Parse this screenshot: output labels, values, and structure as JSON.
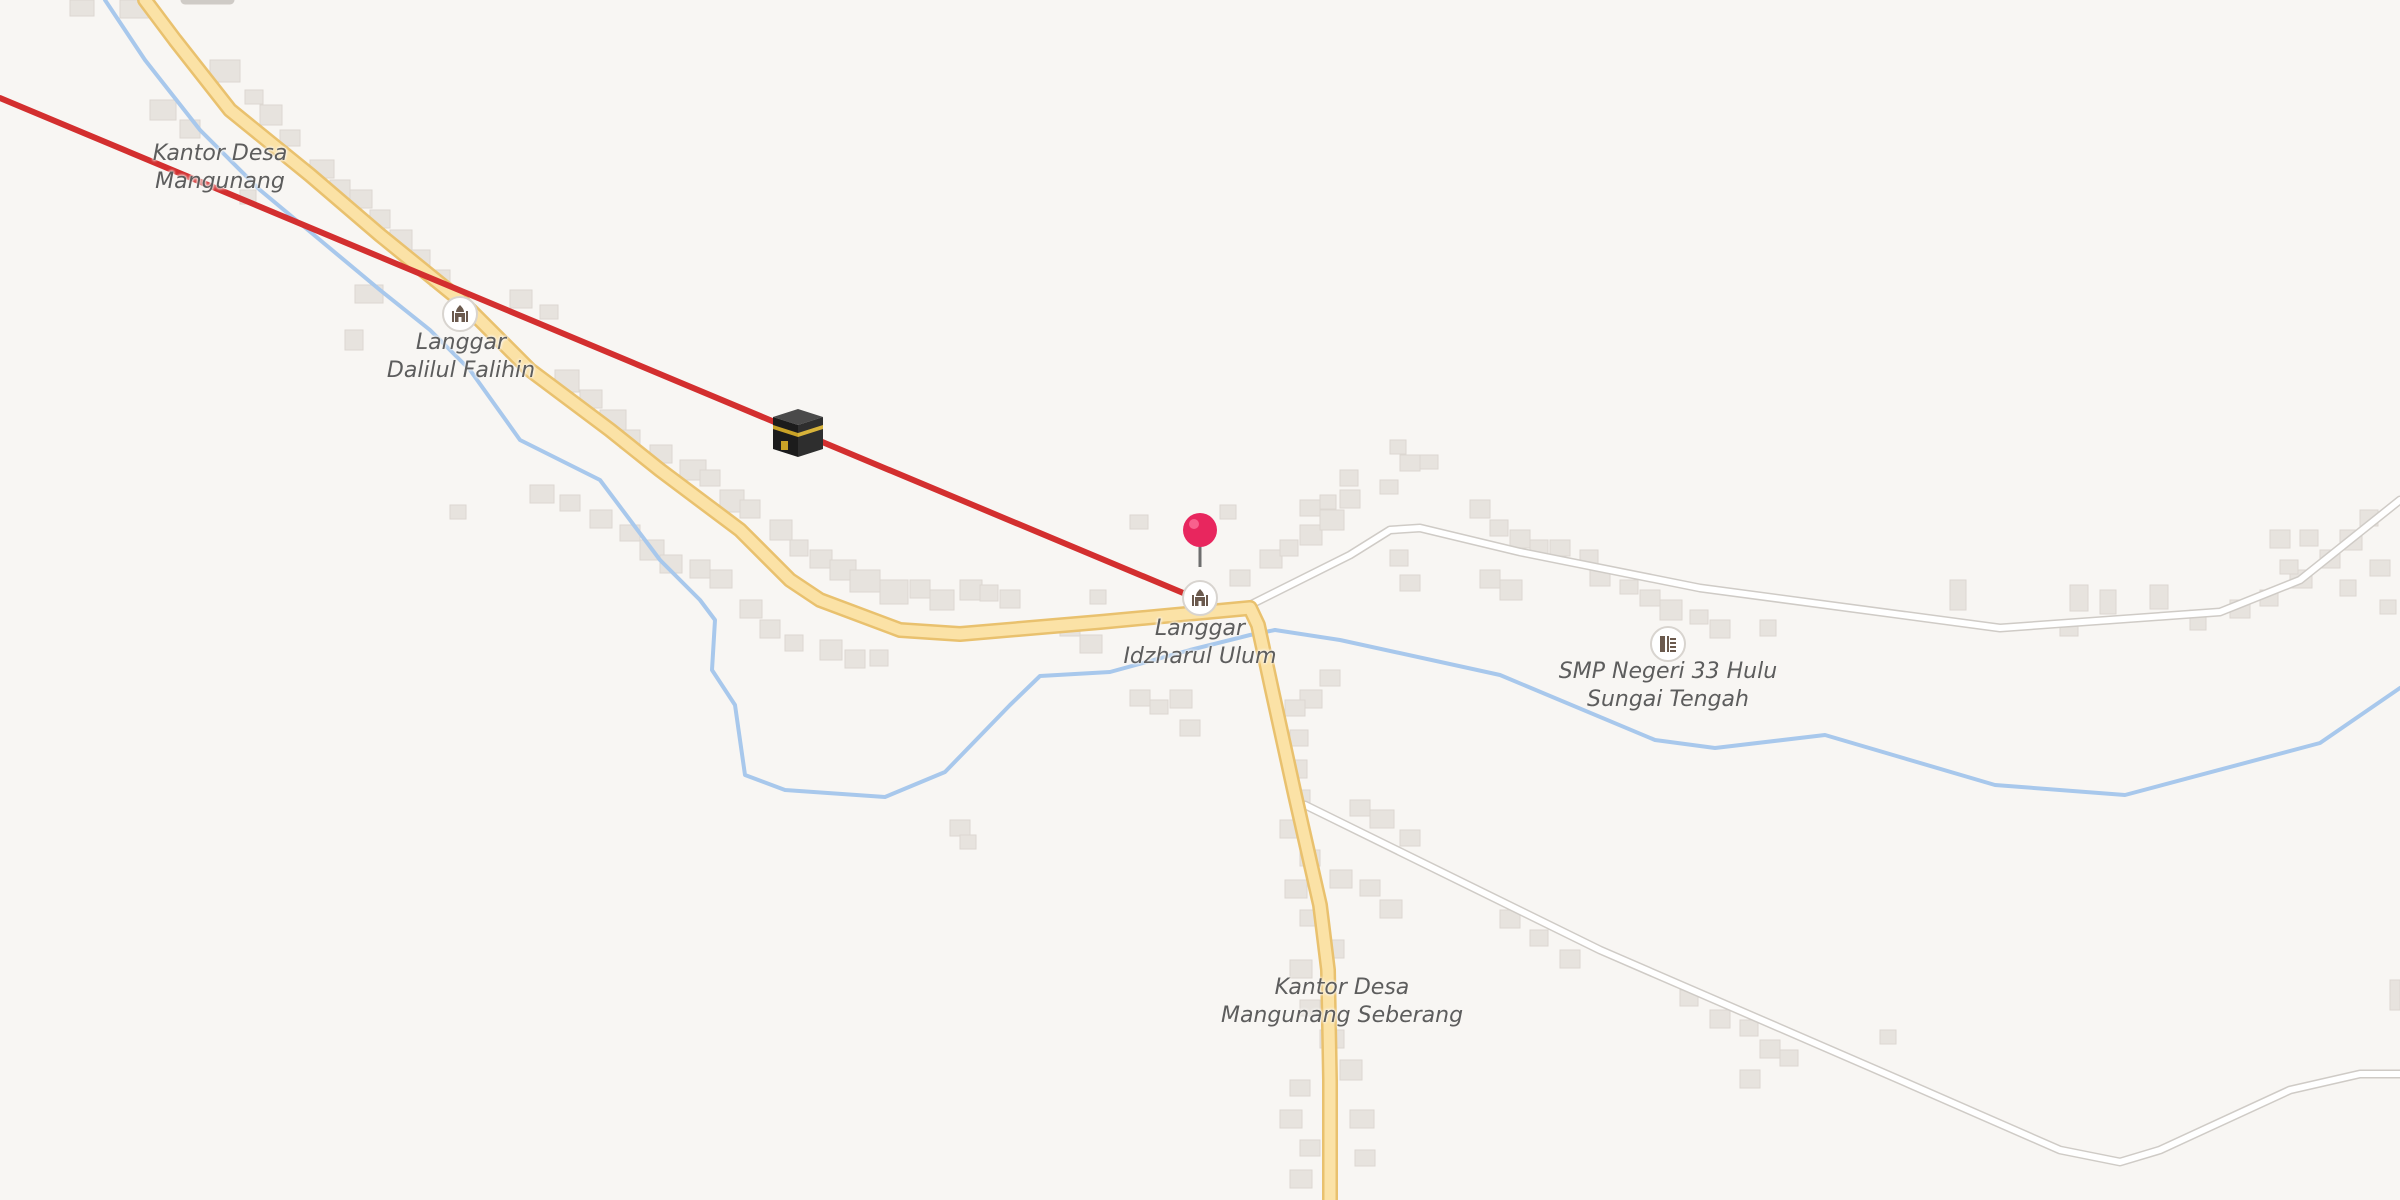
{
  "map": {
    "colors": {
      "background": "#f8f6f3",
      "building": "#e7e3de",
      "road_major": "#fbe2a6",
      "road_major_casing": "#e9c16e",
      "road_minor": "#ffffff",
      "road_minor_casing": "#cfcbc6",
      "river": "#a8c8ec",
      "qibla_line": "#d32f2f",
      "pin": "#e8265e"
    },
    "labels": [
      {
        "id": "kantor-desa-mangunang",
        "lines": [
          "Kantor Desa",
          "Mangunang"
        ]
      },
      {
        "id": "langgar-dalilul-falihin",
        "lines": [
          "Langgar",
          "Dalilul Falihin"
        ]
      },
      {
        "id": "langgar-idzharul-ulum",
        "lines": [
          "Langgar",
          "Idzharul Ulum"
        ]
      },
      {
        "id": "smp-negeri-33",
        "lines": [
          "SMP Negeri 33 Hulu",
          "Sungai Tengah"
        ]
      },
      {
        "id": "kantor-desa-mangunang-seberang",
        "lines": [
          "Kantor Desa",
          "Mangunang Seberang"
        ]
      }
    ],
    "pois": [
      {
        "id": "langgar-dalilul-falihin",
        "icon": "mosque-icon"
      },
      {
        "id": "langgar-idzharul-ulum",
        "icon": "mosque-icon"
      },
      {
        "id": "smp-negeri-33",
        "icon": "school-icon"
      }
    ],
    "markers": {
      "kaaba": {
        "icon": "kaaba-icon"
      },
      "location_pin": {
        "icon": "map-pin-icon"
      }
    },
    "overlay": {
      "qibla_line": {
        "icon": "qibla-direction-line"
      }
    }
  }
}
